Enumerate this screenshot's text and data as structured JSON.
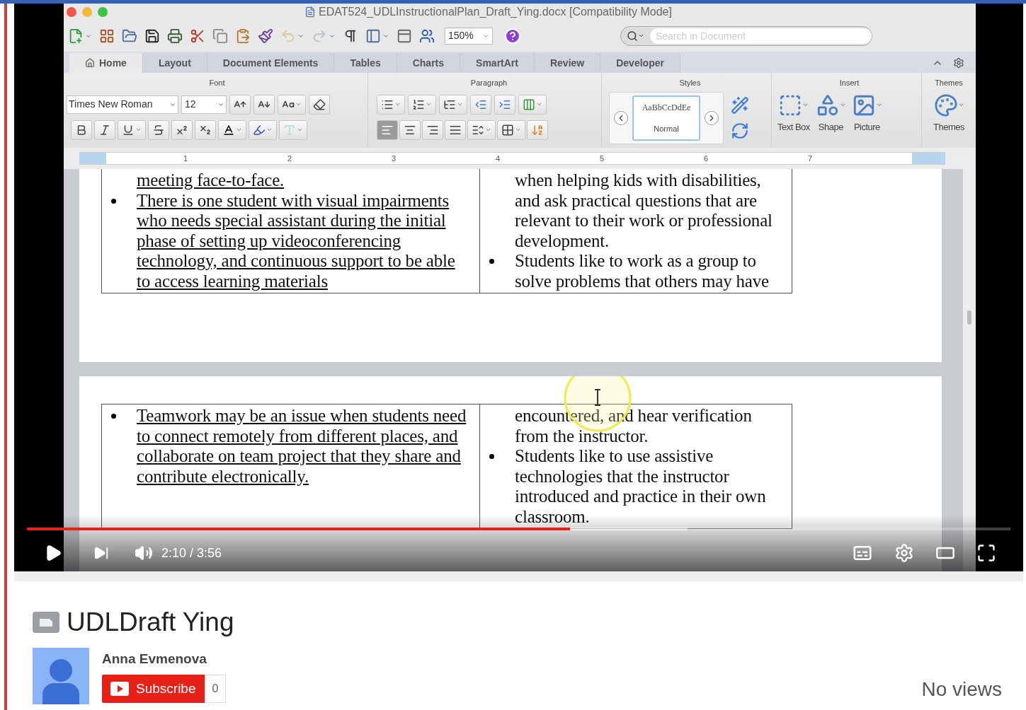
{
  "word": {
    "title": "EDAT524_UDLInstructionalPlan_Draft_Ying.docx [Compatibility Mode]",
    "zoom": "150%",
    "search": {
      "placeholder": "Search in Document"
    },
    "tabs": [
      {
        "label": "Home",
        "selected": true
      },
      {
        "label": "Layout",
        "selected": false
      },
      {
        "label": "Document Elements",
        "selected": false
      },
      {
        "label": "Tables",
        "selected": false
      },
      {
        "label": "Charts",
        "selected": false
      },
      {
        "label": "SmartArt",
        "selected": false
      },
      {
        "label": "Review",
        "selected": false
      },
      {
        "label": "Developer",
        "selected": false
      }
    ],
    "groups": [
      "Font",
      "Paragraph",
      "Styles",
      "Insert",
      "Themes"
    ],
    "font": {
      "name": "Times New Roman",
      "size": "12"
    },
    "align_buttons": [
      {
        "selected": true
      },
      {
        "selected": false
      },
      {
        "selected": false
      },
      {
        "selected": false
      }
    ],
    "style_preview": {
      "sample": "AaBbCcDdEe",
      "name": "Normal"
    },
    "insert_buttons": [
      "Text Box",
      "Shape",
      "Picture"
    ],
    "themes_button": "Themes",
    "ruler_marks": [
      "1",
      "2",
      "3",
      "4",
      "5",
      "6",
      "7"
    ],
    "pages": [
      {
        "cells": [
          {
            "underlined": true,
            "paragraphs": [
              {
                "kind": "continuation",
                "text": "meeting face-to-face."
              },
              {
                "kind": "bullet",
                "text": "There is one student with visual impairments who needs special assistant during the initial phase of setting up videoconferencing technology, and continuous support to be able to access learning materials"
              }
            ]
          },
          {
            "underlined": false,
            "paragraphs": [
              {
                "kind": "continuation",
                "text": "when helping kids with disabilities, and ask practical questions that are relevant to their work or professional development."
              },
              {
                "kind": "bullet",
                "text": "Students like to work as a group to solve problems that others may have"
              }
            ]
          }
        ]
      },
      {
        "cells": [
          {
            "underlined": true,
            "paragraphs": [
              {
                "kind": "bullet",
                "text": "Teamwork may be an issue when students need to connect remotely from different places, and collaborate on team project that they share and contribute electronically."
              }
            ]
          },
          {
            "underlined": false,
            "paragraphs": [
              {
                "kind": "continuation",
                "text": "encountered, and hear verification from the instructor."
              },
              {
                "kind": "bullet",
                "text": "Students like to use assistive technologies that the instructor introduced and practice in their own classroom."
              }
            ]
          }
        ]
      }
    ]
  },
  "player": {
    "progress": {
      "level": 0.552
    },
    "buffer": {
      "level": 0.672
    },
    "time": "2:10 / 3:56"
  },
  "video": {
    "title": "UDLDraft Ying",
    "channel": "Anna Evmenova",
    "subscribe": "Subscribe",
    "subscriber_count": "0",
    "views": "No views"
  }
}
